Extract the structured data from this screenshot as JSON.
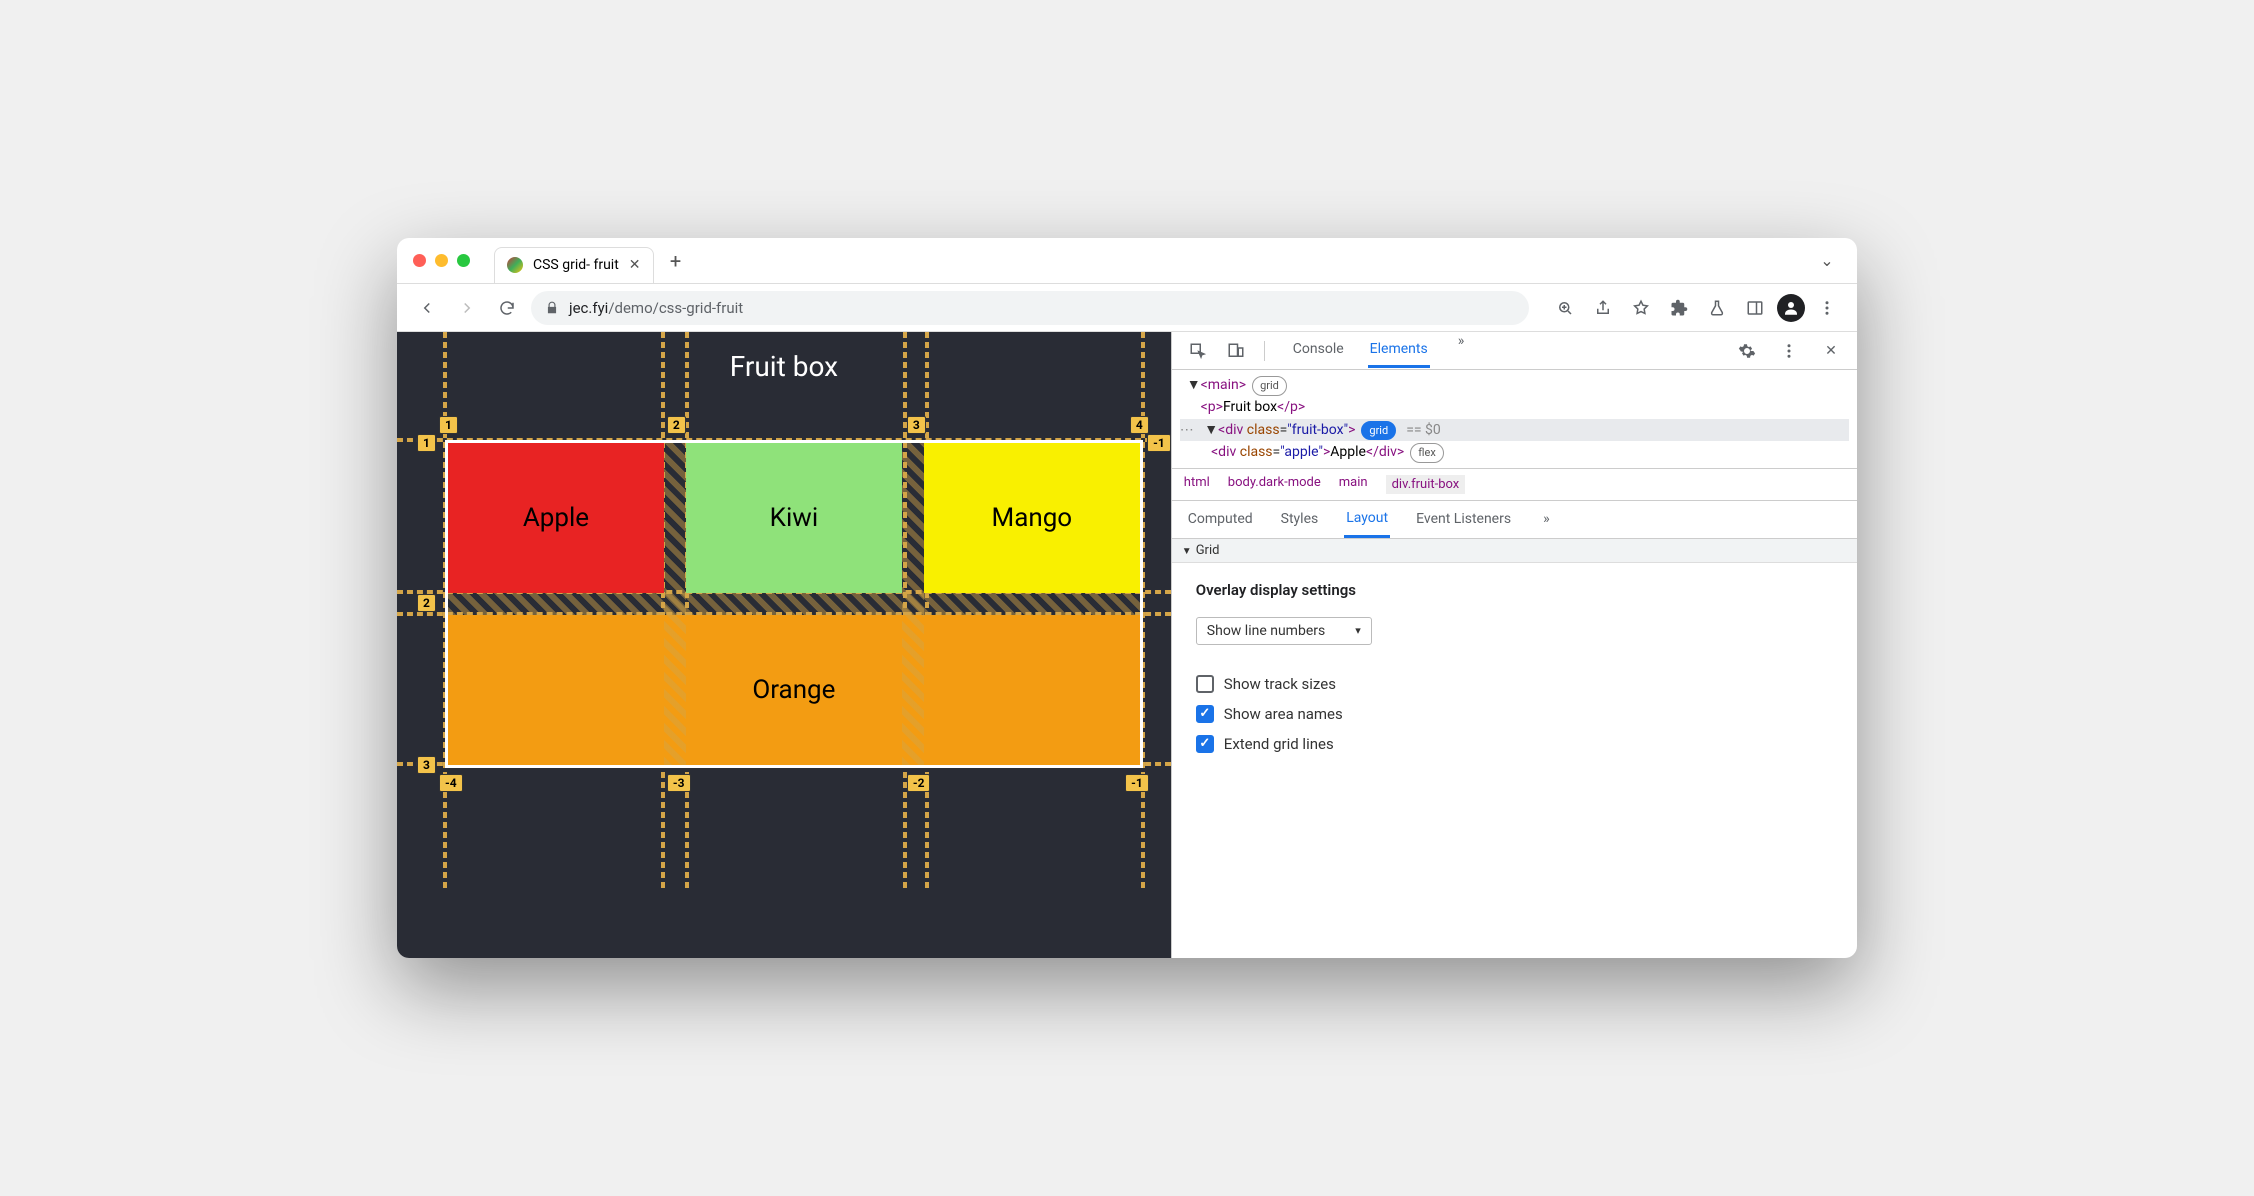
{
  "browser": {
    "tab_title": "CSS grid- fruit",
    "url_host": "jec.fyi",
    "url_path": "/demo/css-grid-fruit"
  },
  "page": {
    "heading": "Fruit box",
    "fruits": {
      "apple": "Apple",
      "kiwi": "Kiwi",
      "mango": "Mango",
      "orange": "Orange"
    },
    "grid_labels": {
      "cols_top": [
        "1",
        "2",
        "3",
        "4"
      ],
      "rows_left": [
        "1",
        "2",
        "3"
      ],
      "neg_right": "-1",
      "neg_bottom": [
        "-4",
        "-3",
        "-2",
        "-1"
      ]
    }
  },
  "devtools": {
    "tabs": {
      "console": "Console",
      "elements": "Elements"
    },
    "dom": {
      "main_open": "<main>",
      "main_badge": "grid",
      "p_open": "<p>",
      "p_text": "Fruit box",
      "p_close": "</p>",
      "div_open": "<div class=\"fruit-box\">",
      "div_badge": "grid",
      "eq": "== $0",
      "apple_open": "<div class=\"apple\">",
      "apple_text": "Apple",
      "apple_close": "</div>",
      "apple_badge": "flex"
    },
    "crumbs": [
      "html",
      "body.dark-mode",
      "main",
      "div.fruit-box"
    ],
    "subtabs": {
      "computed": "Computed",
      "styles": "Styles",
      "layout": "Layout",
      "listeners": "Event Listeners"
    },
    "grid_section": "Grid",
    "overlay_heading": "Overlay display settings",
    "select_value": "Show line numbers",
    "checks": {
      "track": {
        "label": "Show track sizes",
        "checked": false
      },
      "area": {
        "label": "Show area names",
        "checked": true
      },
      "extend": {
        "label": "Extend grid lines",
        "checked": true
      }
    }
  }
}
